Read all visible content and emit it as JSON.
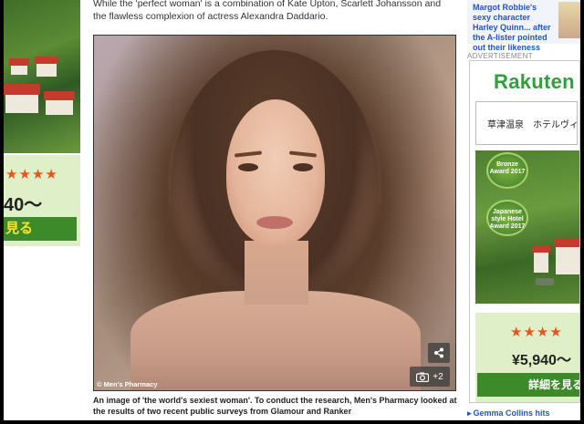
{
  "article": {
    "caption_top": "While the 'perfect woman' is a combination of Kate Upton, Scarlett Johansson and the flawless complexion of actress Alexandra Daddario.",
    "image_credit": "© Men's Pharmacy",
    "gallery_count": "+2",
    "caption_bottom": "An image of 'the world's sexiest woman'. To conduct the research, Men's Pharmacy looked at the results of two recent public surveys from Glamour and Ranker"
  },
  "left_ad": {
    "stars": "★★★★",
    "price": "40〜",
    "button": "見る"
  },
  "right_column": {
    "teaser_text": "Margot Robbie's sexy character Harley Quinn... after the A-lister pointed out their likeness",
    "ad_label": "ADVERTISEMENT",
    "logo": "Rakuten Tr",
    "hotel_name": "草津温泉　ホテルヴィ",
    "award1": "Bronze Award 2017",
    "award2": "Japanese style Hotel Award 2017",
    "stars": "★★★★",
    "price": "¥5,940〜",
    "button": "詳細を見る",
    "teaser2": "Gemma Collins hits"
  },
  "colors": {
    "rakuten_green": "#2fa03a",
    "button_green": "#3d8a2a",
    "star_orange": "#e8541a",
    "link_blue": "#1f56c5"
  }
}
